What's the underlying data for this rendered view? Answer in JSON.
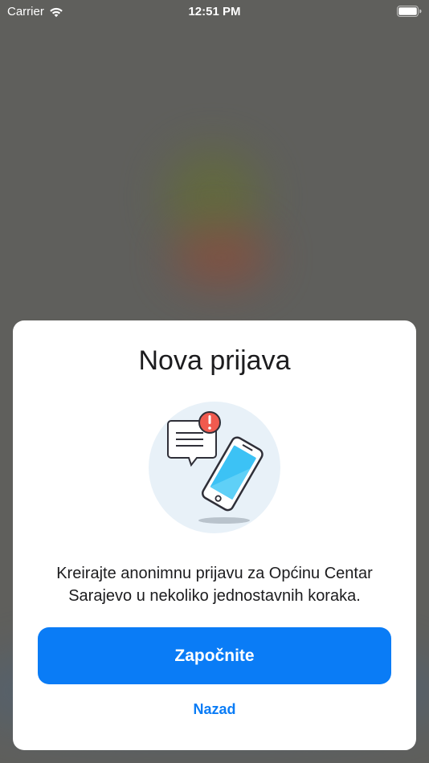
{
  "status_bar": {
    "carrier": "Carrier",
    "time": "12:51 PM",
    "icons": [
      "wifi-icon",
      "battery-icon"
    ]
  },
  "modal": {
    "title": "Nova prijava",
    "illustration": {
      "icons": [
        "speech-bubble-icon",
        "alert-badge-icon",
        "smartphone-icon"
      ],
      "colors": {
        "circle": "#e8f1f8",
        "alert": "#f05a4f",
        "phone_screen": "#3cc2f5",
        "outline": "#2f2f38"
      }
    },
    "description": "Kreirajte anonimnu prijavu za Općinu Centar Sarajevo u nekoliko jednostavnih koraka.",
    "primary_button_label": "Započnite",
    "secondary_link_label": "Nazad"
  },
  "colors": {
    "accent": "#0a7cf6",
    "overlay": "#5f5f5c",
    "card": "#ffffff"
  }
}
